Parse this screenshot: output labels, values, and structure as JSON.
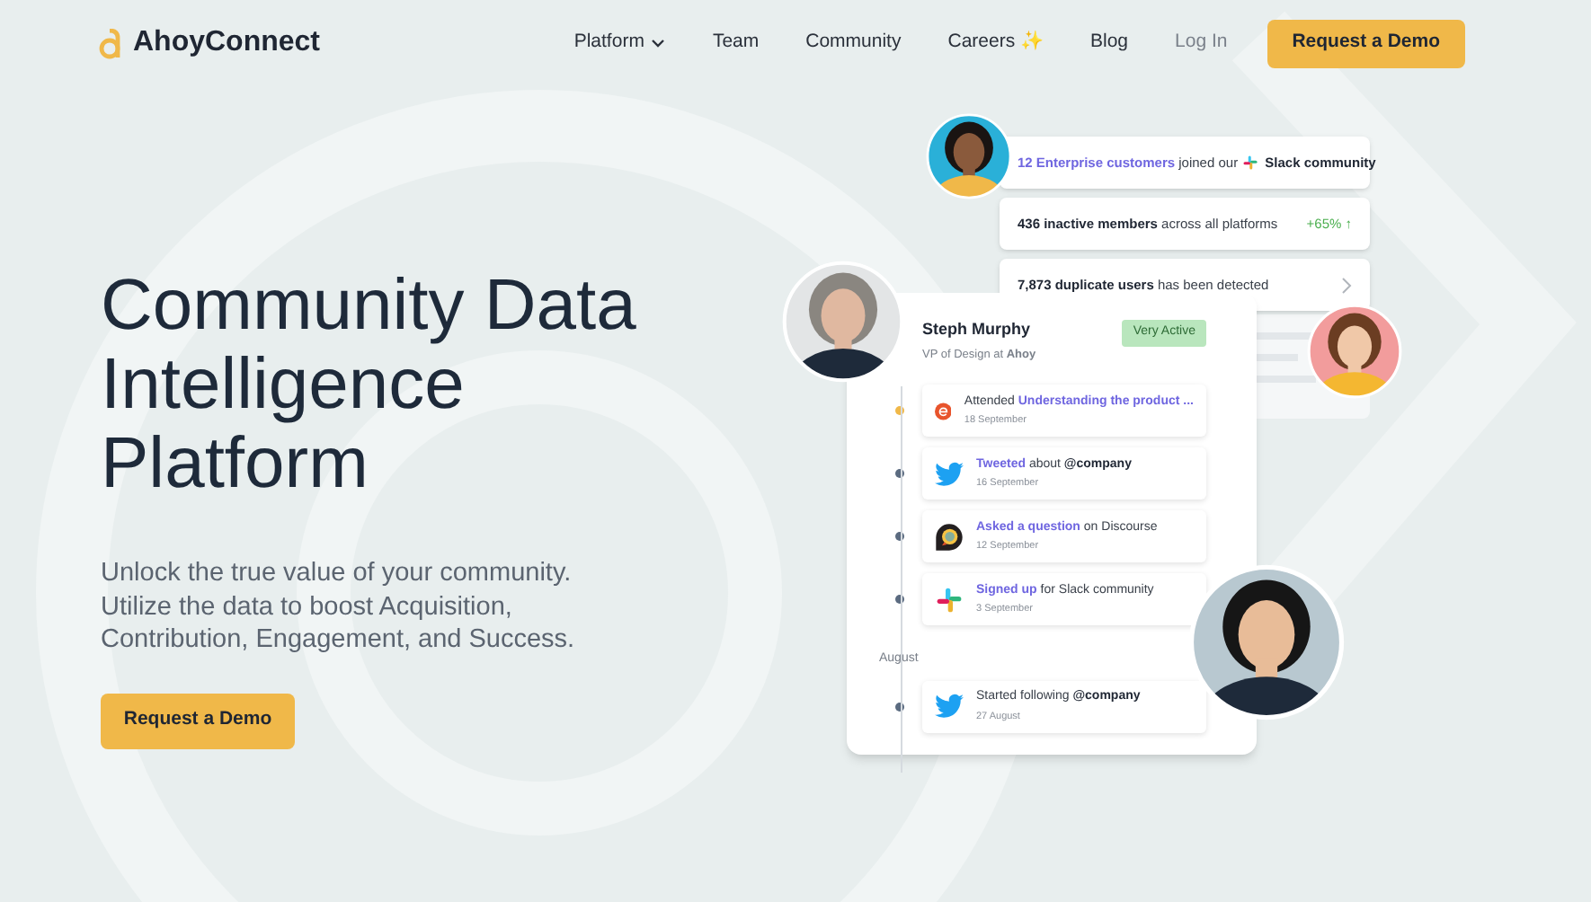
{
  "nav": {
    "logo": "AhoyConnect",
    "links": [
      {
        "label": "Platform",
        "kind": "dropdown"
      },
      {
        "label": "Team",
        "kind": "link"
      },
      {
        "label": "Community",
        "kind": "link"
      },
      {
        "label": "Careers ✨",
        "kind": "link"
      },
      {
        "label": "Blog",
        "kind": "link"
      },
      {
        "label": "Log In",
        "kind": "muted"
      }
    ],
    "cta": "Request a Demo"
  },
  "hero": {
    "title": "Community Data Intelligence Platform",
    "subtitle": "Unlock the true value of your community. Utilize the data to boost Acquisition, Contribution, Engagement, and Success.",
    "cta": "Request a Demo"
  },
  "insights": [
    {
      "segments": [
        {
          "kind": "link",
          "text": "12 Enterprise customers"
        },
        {
          "kind": "plain",
          "text": " joined our "
        },
        {
          "kind": "channel",
          "text": "Slack community"
        }
      ]
    },
    {
      "segments": [
        {
          "kind": "bold",
          "text": "436 inactive members"
        },
        {
          "kind": "plain",
          "text": " across all platforms"
        }
      ],
      "trend": "+65% ↑"
    },
    {
      "segments": [
        {
          "kind": "bold",
          "text": "7,873 duplicate users"
        },
        {
          "kind": "plain",
          "text": " has been detected"
        }
      ],
      "chevron": true
    }
  ],
  "profile": {
    "name": "Steph Murphy",
    "role": "VP of Design at **Ahoy**",
    "badge": "Very Active",
    "timeline": [
      {
        "kind": "event",
        "color": "#f0b849",
        "date": "18 September",
        "segments": [
          {
            "kind": "plain",
            "text": "Attended "
          },
          {
            "kind": "link",
            "text": "Understanding the product ..."
          }
        ]
      },
      {
        "kind": "tweet",
        "color": "#5b6b80",
        "date": "16 September",
        "segments": [
          {
            "kind": "link",
            "text": "Tweeted"
          },
          {
            "kind": "plain",
            "text": " about "
          },
          {
            "kind": "bold",
            "text": "@company"
          }
        ]
      },
      {
        "kind": "forum",
        "color": "#5b6b80",
        "date": "12 September",
        "segments": [
          {
            "kind": "link",
            "text": "Asked a question"
          },
          {
            "kind": "plain",
            "text": " on Discourse"
          }
        ]
      },
      {
        "kind": "chat",
        "color": "#5b6b80",
        "date": "3 September",
        "segments": [
          {
            "kind": "link",
            "text": "Signed up"
          },
          {
            "kind": "plain",
            "text": " for Slack community"
          }
        ]
      },
      {
        "kind": "month",
        "label": "August"
      },
      {
        "kind": "tweet",
        "color": "#5b6b80",
        "date": "27 August",
        "segments": [
          {
            "kind": "plain",
            "text": "Started following "
          },
          {
            "kind": "bold",
            "text": "@company"
          }
        ]
      }
    ]
  }
}
